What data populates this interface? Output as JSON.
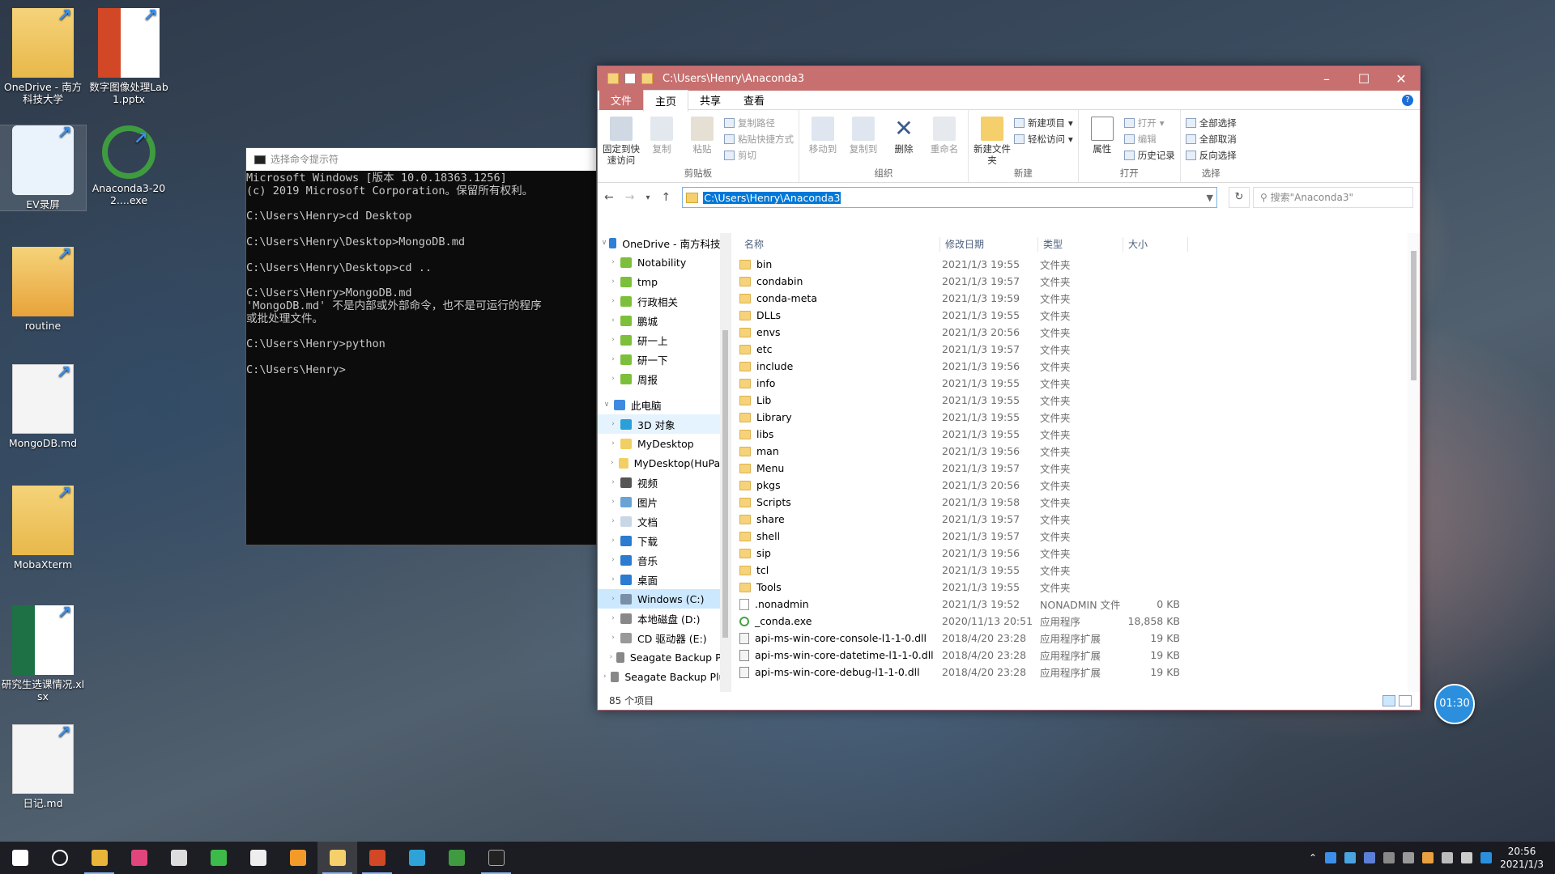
{
  "desktop": {
    "icons": [
      {
        "label": "OneDrive - 南方科技大学",
        "icon": "onedrive-folder-icon"
      },
      {
        "label": "数字图像处理Lab1.pptx",
        "icon": "powerpoint-file-icon"
      },
      {
        "label": "EV录屏",
        "icon": "ev-recorder-icon"
      },
      {
        "label": "Anaconda3-202....exe",
        "icon": "anaconda-installer-icon"
      },
      {
        "label": "routine",
        "icon": "sublime-folder-icon"
      },
      {
        "label": "MongoDB.md",
        "icon": "markdown-file-icon"
      },
      {
        "label": "MobaXterm",
        "icon": "mobaxterm-folder-icon"
      },
      {
        "label": "研究生选课情况.xlsx",
        "icon": "excel-file-icon"
      },
      {
        "label": "日记.md",
        "icon": "markdown-file-icon"
      }
    ]
  },
  "cmd": {
    "title": "选择命令提示符",
    "lines": [
      "Microsoft Windows [版本 10.0.18363.1256]",
      "(c) 2019 Microsoft Corporation。保留所有权利。",
      "",
      "C:\\Users\\Henry>cd Desktop",
      "",
      "C:\\Users\\Henry\\Desktop>MongoDB.md",
      "",
      "C:\\Users\\Henry\\Desktop>cd ..",
      "",
      "C:\\Users\\Henry>MongoDB.md",
      "'MongoDB.md' 不是内部或外部命令，也不是可运行的程序",
      "或批处理文件。",
      "",
      "C:\\Users\\Henry>python",
      "",
      "C:\\Users\\Henry>"
    ]
  },
  "explorer": {
    "title": "C:\\Users\\Henry\\Anaconda3",
    "tabs": {
      "file": "文件",
      "home": "主页",
      "share": "共享",
      "view": "查看"
    },
    "ribbon": {
      "clipboard": {
        "group": "剪贴板",
        "pin": "固定到快速访问",
        "copy": "复制",
        "paste": "粘贴",
        "copy_path": "复制路径",
        "paste_shortcut": "粘贴快捷方式",
        "cut": "剪切"
      },
      "organize": {
        "group": "组织",
        "move_to": "移动到",
        "copy_to": "复制到",
        "delete": "删除",
        "rename": "重命名"
      },
      "new": {
        "group": "新建",
        "new_folder": "新建文件夹",
        "new_item": "新建项目",
        "easy_access": "轻松访问"
      },
      "open": {
        "group": "打开",
        "properties": "属性",
        "open": "打开",
        "edit": "编辑",
        "history": "历史记录"
      },
      "select": {
        "group": "选择",
        "select_all": "全部选择",
        "select_none": "全部取消",
        "invert": "反向选择"
      }
    },
    "address": "C:\\Users\\Henry\\Anaconda3",
    "search_placeholder": "搜索\"Anaconda3\"",
    "nav": [
      {
        "label": "OneDrive - 南方科技大",
        "level": 0,
        "expanded": true,
        "color": "#2f7fd6"
      },
      {
        "label": "Notability",
        "level": 1,
        "color": "#7cbf3a"
      },
      {
        "label": "tmp",
        "level": 1,
        "color": "#7cbf3a"
      },
      {
        "label": "行政相关",
        "level": 1,
        "color": "#7cbf3a"
      },
      {
        "label": "鹏城",
        "level": 1,
        "color": "#7cbf3a"
      },
      {
        "label": "研一上",
        "level": 1,
        "color": "#7cbf3a"
      },
      {
        "label": "研一下",
        "level": 1,
        "color": "#7cbf3a"
      },
      {
        "label": "周报",
        "level": 1,
        "color": "#7cbf3a"
      },
      {
        "label": "此电脑",
        "level": 0,
        "expanded": true,
        "color": "#3d8be0",
        "gap": true
      },
      {
        "label": "3D 对象",
        "level": 1,
        "color": "#2b9fd8",
        "hover": true
      },
      {
        "label": "MyDesktop",
        "level": 1,
        "color": "#f2cf63"
      },
      {
        "label": "MyDesktop(HuPan)",
        "level": 1,
        "color": "#f2cf63"
      },
      {
        "label": "视频",
        "level": 1,
        "color": "#555"
      },
      {
        "label": "图片",
        "level": 1,
        "color": "#6aa3d6"
      },
      {
        "label": "文档",
        "level": 1,
        "color": "#c8d6e6"
      },
      {
        "label": "下载",
        "level": 1,
        "color": "#2b7bd0"
      },
      {
        "label": "音乐",
        "level": 1,
        "color": "#2b7bd0"
      },
      {
        "label": "桌面",
        "level": 1,
        "color": "#2b7bd0"
      },
      {
        "label": "Windows (C:)",
        "level": 1,
        "color": "#7a8ea8",
        "selected": true
      },
      {
        "label": "本地磁盘 (D:)",
        "level": 1,
        "color": "#888"
      },
      {
        "label": "CD 驱动器 (E:)",
        "level": 1,
        "color": "#999"
      },
      {
        "label": "Seagate Backup Plu",
        "level": 1,
        "color": "#888"
      },
      {
        "label": "Seagate Backup Plus",
        "level": 0,
        "color": "#888"
      }
    ],
    "columns": {
      "name": "名称",
      "date": "修改日期",
      "type": "类型",
      "size": "大小"
    },
    "files": [
      {
        "name": "bin",
        "date": "2021/1/3 19:55",
        "type": "文件夹",
        "size": "",
        "kind": "folder"
      },
      {
        "name": "condabin",
        "date": "2021/1/3 19:57",
        "type": "文件夹",
        "size": "",
        "kind": "folder"
      },
      {
        "name": "conda-meta",
        "date": "2021/1/3 19:59",
        "type": "文件夹",
        "size": "",
        "kind": "folder"
      },
      {
        "name": "DLLs",
        "date": "2021/1/3 19:55",
        "type": "文件夹",
        "size": "",
        "kind": "folder"
      },
      {
        "name": "envs",
        "date": "2021/1/3 20:56",
        "type": "文件夹",
        "size": "",
        "kind": "folder"
      },
      {
        "name": "etc",
        "date": "2021/1/3 19:57",
        "type": "文件夹",
        "size": "",
        "kind": "folder"
      },
      {
        "name": "include",
        "date": "2021/1/3 19:56",
        "type": "文件夹",
        "size": "",
        "kind": "folder"
      },
      {
        "name": "info",
        "date": "2021/1/3 19:55",
        "type": "文件夹",
        "size": "",
        "kind": "folder"
      },
      {
        "name": "Lib",
        "date": "2021/1/3 19:55",
        "type": "文件夹",
        "size": "",
        "kind": "folder"
      },
      {
        "name": "Library",
        "date": "2021/1/3 19:55",
        "type": "文件夹",
        "size": "",
        "kind": "folder"
      },
      {
        "name": "libs",
        "date": "2021/1/3 19:55",
        "type": "文件夹",
        "size": "",
        "kind": "folder"
      },
      {
        "name": "man",
        "date": "2021/1/3 19:56",
        "type": "文件夹",
        "size": "",
        "kind": "folder"
      },
      {
        "name": "Menu",
        "date": "2021/1/3 19:57",
        "type": "文件夹",
        "size": "",
        "kind": "folder"
      },
      {
        "name": "pkgs",
        "date": "2021/1/3 20:56",
        "type": "文件夹",
        "size": "",
        "kind": "folder"
      },
      {
        "name": "Scripts",
        "date": "2021/1/3 19:58",
        "type": "文件夹",
        "size": "",
        "kind": "folder"
      },
      {
        "name": "share",
        "date": "2021/1/3 19:57",
        "type": "文件夹",
        "size": "",
        "kind": "folder"
      },
      {
        "name": "shell",
        "date": "2021/1/3 19:57",
        "type": "文件夹",
        "size": "",
        "kind": "folder"
      },
      {
        "name": "sip",
        "date": "2021/1/3 19:56",
        "type": "文件夹",
        "size": "",
        "kind": "folder"
      },
      {
        "name": "tcl",
        "date": "2021/1/3 19:55",
        "type": "文件夹",
        "size": "",
        "kind": "folder"
      },
      {
        "name": "Tools",
        "date": "2021/1/3 19:55",
        "type": "文件夹",
        "size": "",
        "kind": "folder"
      },
      {
        "name": ".nonadmin",
        "date": "2021/1/3 19:52",
        "type": "NONADMIN 文件",
        "size": "0 KB",
        "kind": "doc"
      },
      {
        "name": "_conda.exe",
        "date": "2020/11/13 20:51",
        "type": "应用程序",
        "size": "18,858 KB",
        "kind": "exe"
      },
      {
        "name": "api-ms-win-core-console-l1-1-0.dll",
        "date": "2018/4/20 23:28",
        "type": "应用程序扩展",
        "size": "19 KB",
        "kind": "dll"
      },
      {
        "name": "api-ms-win-core-datetime-l1-1-0.dll",
        "date": "2018/4/20 23:28",
        "type": "应用程序扩展",
        "size": "19 KB",
        "kind": "dll"
      },
      {
        "name": "api-ms-win-core-debug-l1-1-0.dll",
        "date": "2018/4/20 23:28",
        "type": "应用程序扩展",
        "size": "19 KB",
        "kind": "dll"
      }
    ],
    "status": "85 个项目"
  },
  "timer": "01:30",
  "taskbar": {
    "apps": [
      "windows-start-icon",
      "cortana-icon",
      "chrome-icon",
      "pointer-app-icon",
      "terminal-icon",
      "wechat-icon",
      "typora-icon",
      "sublime-icon",
      "file-explorer-icon",
      "powerpoint-icon",
      "edge-icon",
      "anaconda-icon",
      "cmd-icon"
    ],
    "time": "20:56",
    "date": "2021/1/3"
  }
}
